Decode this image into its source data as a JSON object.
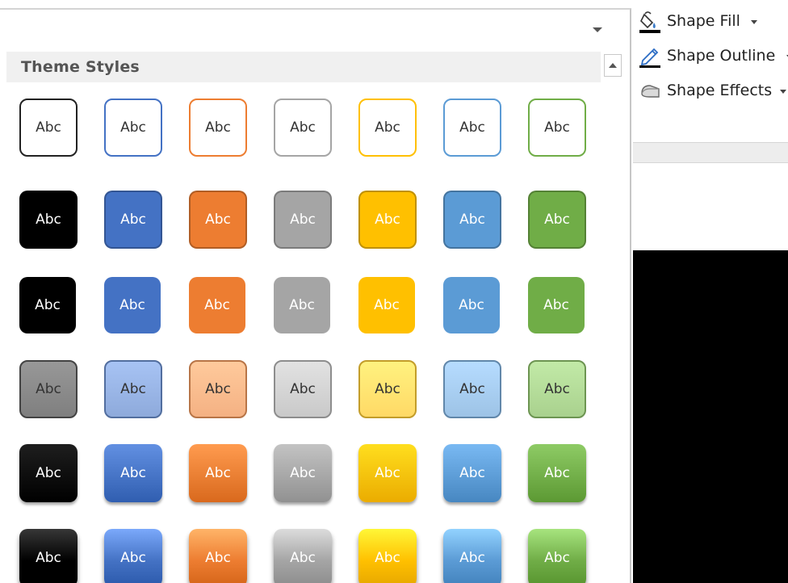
{
  "gallery": {
    "section_title": "Theme Styles",
    "swatch_label": "Abc",
    "theme_colors": [
      "#000000",
      "#4472c4",
      "#ed7d31",
      "#a5a5a5",
      "#ffc000",
      "#5b9bd5",
      "#70ad47"
    ],
    "rows": [
      {
        "style": "colored-outline",
        "cells": [
          {
            "label": "Abc",
            "color": "#000000"
          },
          {
            "label": "Abc",
            "color": "#4472c4"
          },
          {
            "label": "Abc",
            "color": "#ed7d31"
          },
          {
            "label": "Abc",
            "color": "#a5a5a5"
          },
          {
            "label": "Abc",
            "color": "#ffc000"
          },
          {
            "label": "Abc",
            "color": "#5b9bd5"
          },
          {
            "label": "Abc",
            "color": "#70ad47"
          }
        ]
      },
      {
        "style": "colored-fill",
        "cells": [
          {
            "label": "Abc",
            "color": "#000000"
          },
          {
            "label": "Abc",
            "color": "#4472c4"
          },
          {
            "label": "Abc",
            "color": "#ed7d31"
          },
          {
            "label": "Abc",
            "color": "#a5a5a5"
          },
          {
            "label": "Abc",
            "color": "#ffc000"
          },
          {
            "label": "Abc",
            "color": "#5b9bd5"
          },
          {
            "label": "Abc",
            "color": "#70ad47"
          }
        ]
      },
      {
        "style": "colored-fill-white-outline",
        "cells": [
          {
            "label": "Abc",
            "color": "#000000"
          },
          {
            "label": "Abc",
            "color": "#4472c4"
          },
          {
            "label": "Abc",
            "color": "#ed7d31"
          },
          {
            "label": "Abc",
            "color": "#a5a5a5"
          },
          {
            "label": "Abc",
            "color": "#ffc000"
          },
          {
            "label": "Abc",
            "color": "#5b9bd5"
          },
          {
            "label": "Abc",
            "color": "#70ad47"
          }
        ]
      },
      {
        "style": "colored-fill-light",
        "cells": [
          {
            "label": "Abc",
            "color": "#7f7f7f"
          },
          {
            "label": "Abc",
            "color": "#8eaadb"
          },
          {
            "label": "Abc",
            "color": "#f4b183"
          },
          {
            "label": "Abc",
            "color": "#c9c9c9"
          },
          {
            "label": "Abc",
            "color": "#ffd966"
          },
          {
            "label": "Abc",
            "color": "#9dc3e6"
          },
          {
            "label": "Abc",
            "color": "#a9d18e"
          }
        ]
      },
      {
        "style": "intense-effect",
        "cells": [
          {
            "label": "Abc",
            "color": "#000000"
          },
          {
            "label": "Abc",
            "color": "#4472c4"
          },
          {
            "label": "Abc",
            "color": "#ed7d31"
          },
          {
            "label": "Abc",
            "color": "#a5a5a5"
          },
          {
            "label": "Abc",
            "color": "#ffc000"
          },
          {
            "label": "Abc",
            "color": "#5b9bd5"
          },
          {
            "label": "Abc",
            "color": "#70ad47"
          }
        ]
      },
      {
        "style": "intense-effect-shadow",
        "cells": [
          {
            "label": "Abc",
            "color": "#000000"
          },
          {
            "label": "Abc",
            "color": "#4472c4"
          },
          {
            "label": "Abc",
            "color": "#ed7d31"
          },
          {
            "label": "Abc",
            "color": "#a5a5a5"
          },
          {
            "label": "Abc",
            "color": "#ffc000"
          },
          {
            "label": "Abc",
            "color": "#5b9bd5"
          },
          {
            "label": "Abc",
            "color": "#70ad47"
          }
        ]
      }
    ]
  },
  "ribbon": {
    "shape_fill": {
      "label": "Shape Fill",
      "icon": "paint-bucket-icon"
    },
    "shape_outline": {
      "label": "Shape Outline",
      "icon": "pencil-icon"
    },
    "shape_effects": {
      "label": "Shape Effects",
      "icon": "shape-effects-icon"
    },
    "dropdown_icon": "chevron-down-icon"
  }
}
